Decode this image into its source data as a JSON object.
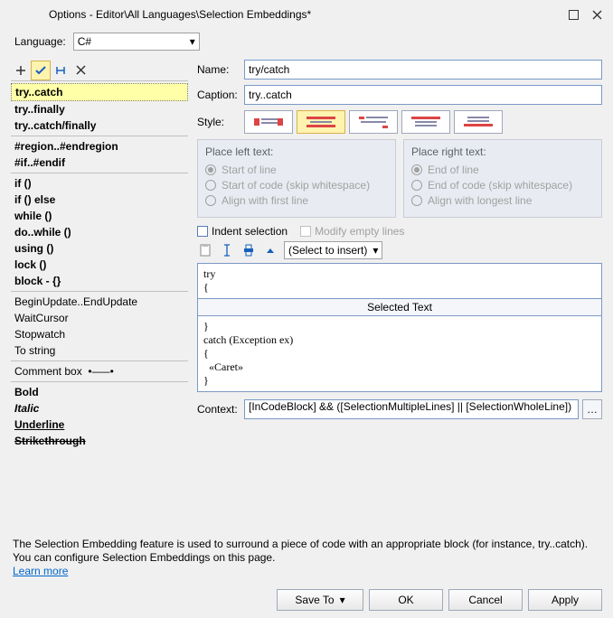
{
  "title": "Options - Editor\\All Languages\\Selection Embeddings*",
  "language": {
    "label": "Language:",
    "value": "C#"
  },
  "list": {
    "group1": [
      "try..catch",
      "try..finally",
      "try..catch/finally"
    ],
    "group2": [
      "#region..#endregion",
      "#if..#endif"
    ],
    "group3": [
      "if ()",
      "if () else",
      "while ()",
      "do..while ()",
      "using ()",
      "lock ()",
      "block - {}"
    ],
    "group4": [
      "BeginUpdate..EndUpdate",
      "WaitCursor",
      "Stopwatch",
      "To string"
    ],
    "group5_label": "Comment box",
    "group6": [
      "Bold",
      "Italic",
      "Underline",
      "Strikethrough"
    ]
  },
  "form": {
    "name_label": "Name:",
    "name_value": "try/catch",
    "caption_label": "Caption:",
    "caption_value": "try..catch",
    "style_label": "Style:"
  },
  "place_left": {
    "title": "Place left text:",
    "o1": "Start of line",
    "o2": "Start of code (skip whitespace)",
    "o3": "Align with first line"
  },
  "place_right": {
    "title": "Place right text:",
    "o1": "End of line",
    "o2": "End of code (skip whitespace)",
    "o3": "Align with longest line"
  },
  "checks": {
    "indent": "Indent selection",
    "modify": "Modify empty lines"
  },
  "insert_select": "(Select to insert)",
  "code_top": "try\n{",
  "sel_text_label": "Selected Text",
  "code_bottom": "}\ncatch (Exception ex)\n{\n  «Caret»\n}",
  "context": {
    "label": "Context:",
    "value": "[InCodeBlock] && ([SelectionMultipleLines] || [SelectionWholeLine])"
  },
  "description": {
    "line1": "The Selection Embedding feature is used to surround a piece of code with an appropriate block (for instance, try..catch).",
    "line2": "You can configure Selection Embeddings on this page.",
    "learn": "Learn more"
  },
  "buttons": {
    "saveto": "Save To",
    "ok": "OK",
    "cancel": "Cancel",
    "apply": "Apply"
  }
}
